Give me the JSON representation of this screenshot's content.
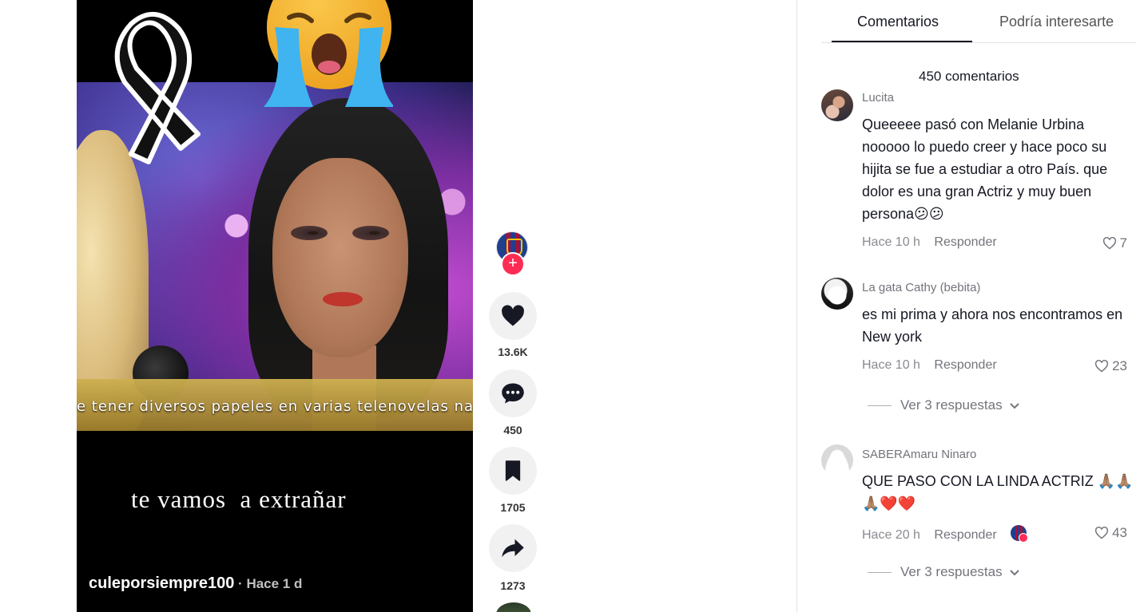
{
  "video": {
    "caption_strip": "e tener diversos papeles en varias telenovelas nac",
    "overlay_text": "te vamos  a extrañar",
    "author": "culeporsiempre100",
    "separator": " · ",
    "posted": "Hace 1 d"
  },
  "actions": {
    "follow_symbol": "+",
    "likes": "13.6K",
    "comments": "450",
    "saves": "1705",
    "shares": "1273"
  },
  "panel": {
    "tabs": [
      {
        "label": "Comentarios",
        "active": true
      },
      {
        "label": "Podría interesarte",
        "active": false
      }
    ],
    "count_label": "450 comentarios",
    "reply_label": "Responder",
    "comments": [
      {
        "user": "Lucita",
        "text": "Queeeee pasó con Melanie Urbina nooooo lo puedo creer y hace poco su hijita se fue a estudiar a otro País. que dolor es una gran Actriz y muy buen persona😕😕",
        "time": "Hace 10 h",
        "likes": "7"
      },
      {
        "user": "La gata Cathy (bebita)",
        "text": "es mi prima y ahora nos encontramos en New york",
        "time": "Hace 10 h",
        "likes": "23",
        "replies": "Ver 3 respuestas"
      },
      {
        "user": "SABERAmaru Ninaro",
        "text": "QUE PASO CON LA LINDA ACTRIZ 🙏🏽🙏🏽🙏🏽❤️❤️",
        "time": "Hace 20 h",
        "likes": "43",
        "creator_liked": true,
        "replies": "Ver 3 respuestas"
      }
    ]
  },
  "colors": {
    "accent": "#fe2c55",
    "text_primary": "#161823",
    "text_secondary": "#73747b",
    "button_bg": "#f1f1f2"
  },
  "icons": [
    "heart-icon",
    "comment-icon",
    "bookmark-icon",
    "share-icon",
    "plus-icon",
    "chevron-down-icon",
    "like-outline-icon",
    "mourning-ribbon-icon",
    "crying-face-emoji"
  ]
}
